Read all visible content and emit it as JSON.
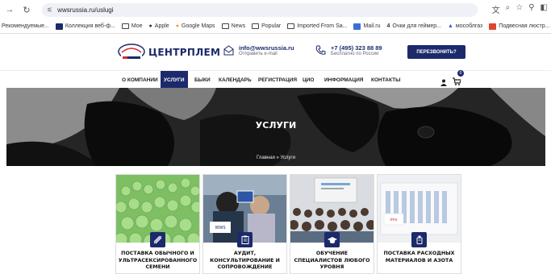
{
  "browser": {
    "url": "wwsrussia.ru/uslugi",
    "bookmarks": [
      {
        "label": "Рекомендуемые...",
        "icon": "none"
      },
      {
        "label": "Коллекция веб-ф...",
        "icon": "collection-icon"
      },
      {
        "label": "Мое",
        "icon": "folder-icon"
      },
      {
        "label": "Apple",
        "icon": "apple-icon"
      },
      {
        "label": "Google Maps",
        "icon": "maps-icon"
      },
      {
        "label": "News",
        "icon": "folder-icon"
      },
      {
        "label": "Popular",
        "icon": "folder-icon"
      },
      {
        "label": "Imported From Sa...",
        "icon": "folder-icon"
      },
      {
        "label": "Mail.ru",
        "icon": "mail-icon"
      },
      {
        "label": "Очки для геймер...",
        "icon": "glasses-icon"
      },
      {
        "label": "мособлгаз",
        "icon": "mosoblgaz-icon"
      },
      {
        "label": "Подвесная люстр...",
        "icon": "lamp-icon"
      }
    ]
  },
  "header": {
    "logo_text": "ЦЕНТРПЛЕМ",
    "email": "info@wwsrussia.ru",
    "email_sub": "Отправить e-mail",
    "phone": "+7 (495) 323 88 89",
    "phone_sub": "Бесплатно по России",
    "cta": "ПЕРЕЗВОНИТЬ?"
  },
  "menu": {
    "items": [
      "О КОМПАНИИ",
      "УСЛУГИ",
      "БЫКИ",
      "КАЛЕНДАРЬ",
      "РЕГИСТРАЦИЯ",
      "ЦИО",
      "ИНФОРМАЦИЯ",
      "КОНТАКТЫ"
    ],
    "active": "УСЛУГИ",
    "cart_count": "0"
  },
  "hero": {
    "title": "УСЛУГИ",
    "breadcrumb": "Главная » Услуги"
  },
  "cards": [
    {
      "title": "ПОСТАВКА ОБЫЧНОГО И УЛЬТРАСЕКСИРОВАННОГО СЕМЕНИ",
      "icon": "straws-icon"
    },
    {
      "title": "АУДИТ, КОНСУЛЬТИРОВАНИЕ И СОПРОВОЖДЕНИЕ",
      "icon": "clipboard-icon"
    },
    {
      "title": "ОБУЧЕНИЕ СПЕЦИАЛИСТОВ ЛЮБОГО УРОВНЯ",
      "icon": "graduation-cap-icon"
    },
    {
      "title": "ПОСТАВКА РАСХОДНЫХ МАТЕРИАЛОВ И АЗОТА",
      "icon": "bottle-icon"
    }
  ],
  "colors": {
    "brand": "#1c2a6b",
    "accent_red": "#d42a2a"
  }
}
